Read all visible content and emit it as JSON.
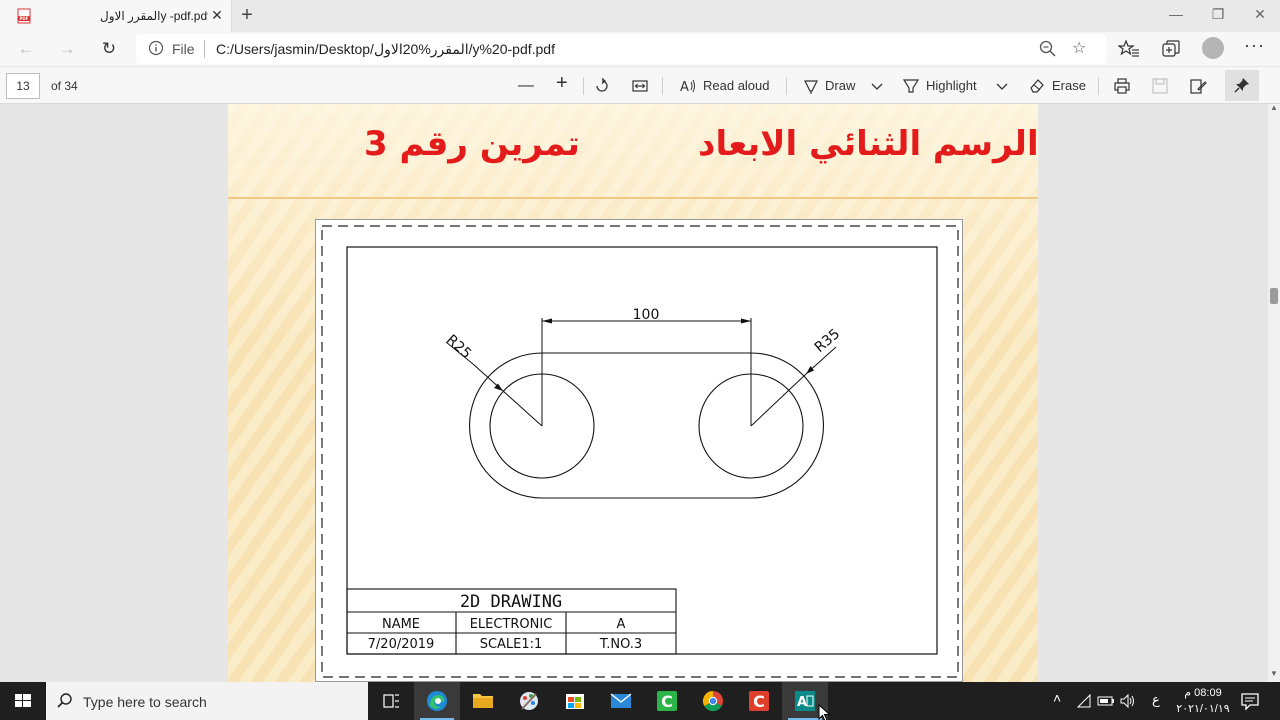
{
  "browser": {
    "tab": {
      "title": "المقرر الاولy -pdf.pdf",
      "close": "✕"
    },
    "new_tab": "+",
    "window_controls": {
      "minimize": "—",
      "maximize": "❐",
      "close": "✕"
    },
    "nav": {
      "back": "←",
      "forward": "→",
      "refresh": "↻"
    },
    "address": {
      "scheme_label": "File",
      "url": "C:/Users/jasmin/Desktop/المقرر%20الاول/y%20-pdf.pdf"
    },
    "more": "···"
  },
  "pdf_toolbar": {
    "page_number": "13",
    "page_count": "of 34",
    "zoom_out": "—",
    "zoom_in": "+",
    "read_aloud": "Read aloud",
    "draw": "Draw",
    "highlight": "Highlight",
    "erase": "Erase"
  },
  "document": {
    "title_main": "الرسم الثنائي الابعاد",
    "title_exercise": "تمرين رقم 3",
    "drawing": {
      "dimension": "100",
      "radius_small": "R25",
      "radius_large": "R35",
      "title_block": {
        "title": "2D DRAWING",
        "row1": [
          "NAME",
          "ELECTRONIC",
          "A"
        ],
        "row2": [
          "7/20/2019",
          "SCALE1:1",
          "T.NO.3"
        ]
      }
    }
  },
  "taskbar": {
    "search_placeholder": "Type here to search",
    "language": "ع",
    "time": "08:09 م",
    "date": "٢٠٢١/٠١/١٩"
  },
  "colors": {
    "title_red": "#e31b1b",
    "taskbar": "#1f1f1f",
    "accent": "#0078d7"
  }
}
